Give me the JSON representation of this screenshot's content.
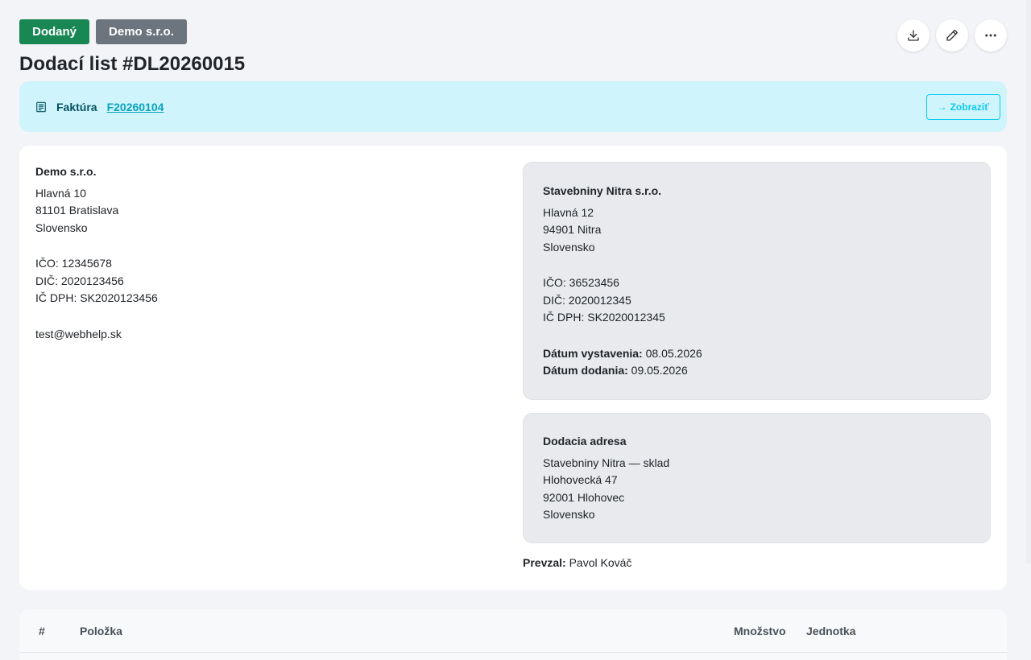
{
  "header": {
    "status_badge": "Dodaný",
    "company_badge": "Demo s.r.o.",
    "title": "Dodací list #DL20260015",
    "actions": [
      "download-icon",
      "edit-icon",
      "more-icon"
    ]
  },
  "invoice_alert": {
    "label": "Faktúra",
    "number": "F20260104",
    "show_button": "Zobraziť",
    "show_icon": "→"
  },
  "supplier": {
    "name": "Demo s.r.o.",
    "street": "Hlavná 10",
    "city": "81101 Bratislava",
    "country": "Slovensko",
    "ico": "IČO: 12345678",
    "dic": "DIČ: 2020123456",
    "ic_dph": "IČ DPH: SK2020123456",
    "email": "test@webhelp.sk"
  },
  "customer": {
    "name": "Stavebniny Nitra s.r.o.",
    "street": "Hlavná 12",
    "city": "94901 Nitra",
    "country": "Slovensko",
    "ico": "IČO: 36523456",
    "dic": "DIČ: 2020012345",
    "ic_dph": "IČ DPH: SK2020012345",
    "issue_date_label": "Dátum vystavenia:",
    "issue_date": "08.05.2026",
    "delivery_date_label": "Dátum dodania:",
    "delivery_date": "09.05.2026"
  },
  "delivery_address": {
    "title": "Dodacia adresa",
    "name": "Stavebniny Nitra — sklad",
    "street": "Hlohovecká 47",
    "city": "92001 Hlohovec",
    "country": "Slovensko"
  },
  "received": {
    "label": "Prevzal:",
    "name": "Pavol Kováč"
  },
  "items_table": {
    "columns": [
      "#",
      "Položka",
      "Množstvo",
      "Jednotka"
    ]
  },
  "colors": {
    "success": "#198754",
    "secondary": "#6c757d",
    "info_bg": "#cff4fc",
    "info": "#0dcaf0"
  }
}
